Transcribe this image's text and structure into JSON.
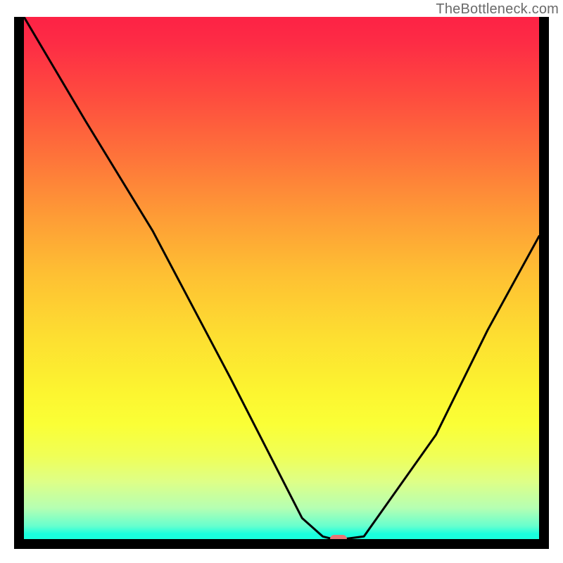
{
  "watermark": "TheBottleneck.com",
  "chart_data": {
    "type": "line",
    "title": "",
    "xlabel": "",
    "ylabel": "",
    "xlim": [
      0,
      100
    ],
    "ylim": [
      0,
      100
    ],
    "grid": false,
    "series": [
      {
        "name": "curve",
        "x": [
          0,
          12,
          25,
          40,
          54,
          58,
          60,
          62,
          66,
          80,
          90,
          100
        ],
        "y": [
          100,
          80,
          59,
          31,
          4,
          0.5,
          0,
          0,
          0.5,
          20,
          40,
          58
        ]
      }
    ],
    "marker": {
      "x": 61,
      "y": 0
    },
    "gradient_note": "vertical heatmap background from red (top) through yellow to green (bottom)",
    "colors": {
      "top": "#fd2245",
      "mid": "#fdde31",
      "bottom": "#1affde",
      "curve": "#000000",
      "marker": "#e77676",
      "frame": "#000000"
    }
  }
}
